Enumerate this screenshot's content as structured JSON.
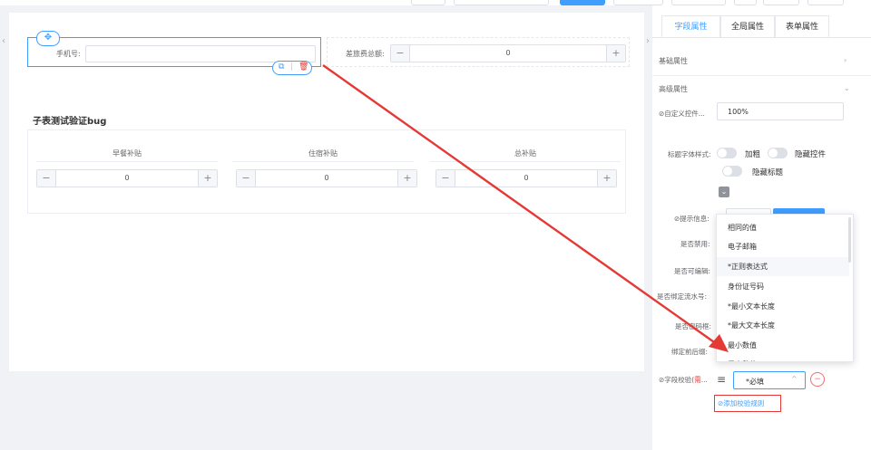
{
  "form": {
    "phone_label": "手机号:",
    "total_label": "差旅费总额:",
    "total_value": "0",
    "subform_title": "子表测试验证bug",
    "columns": [
      {
        "header": "早餐补贴",
        "value": "0"
      },
      {
        "header": "住宿补贴",
        "value": "0"
      },
      {
        "header": "总补贴",
        "value": "0"
      }
    ],
    "icons": {
      "move": "move-icon",
      "copy": "copy-icon",
      "delete": "delete-icon"
    }
  },
  "panel": {
    "tabs": [
      "字段属性",
      "全局属性",
      "表单属性"
    ],
    "active_tab": "字段属性",
    "basic_section": "基础属性",
    "advanced_section": "高级属性",
    "custom_control_label": "⊘自定义控件...",
    "custom_control_value": "100%",
    "title_font_label": "标题字体样式:",
    "bold_label": "加粗",
    "hide_control_label": "隐藏控件",
    "hide_title_label": "隐藏标题",
    "hint_label": "⊘提示信息:",
    "disabled_label": "是否禁用:",
    "editable_label": "是否可编辑:",
    "serial_label": "是否绑定流水号:",
    "password_label": "是否密码框:",
    "bind_before_label": "绑定前后缀:",
    "validation_label": "⊘字段校验",
    "validation_label_red": "(需...",
    "validation_value": "*必填",
    "add_rule": "⊘添加校验规则"
  },
  "dropdown": {
    "items": [
      "相同的值",
      "电子邮箱",
      "*正则表达式",
      "身份证号码",
      "*最小文本长度",
      "*最大文本长度",
      "最小数值",
      "最大数值"
    ],
    "hovered": "*正则表达式"
  },
  "colors": {
    "accent": "#409eff",
    "annotation": "#e53935"
  }
}
